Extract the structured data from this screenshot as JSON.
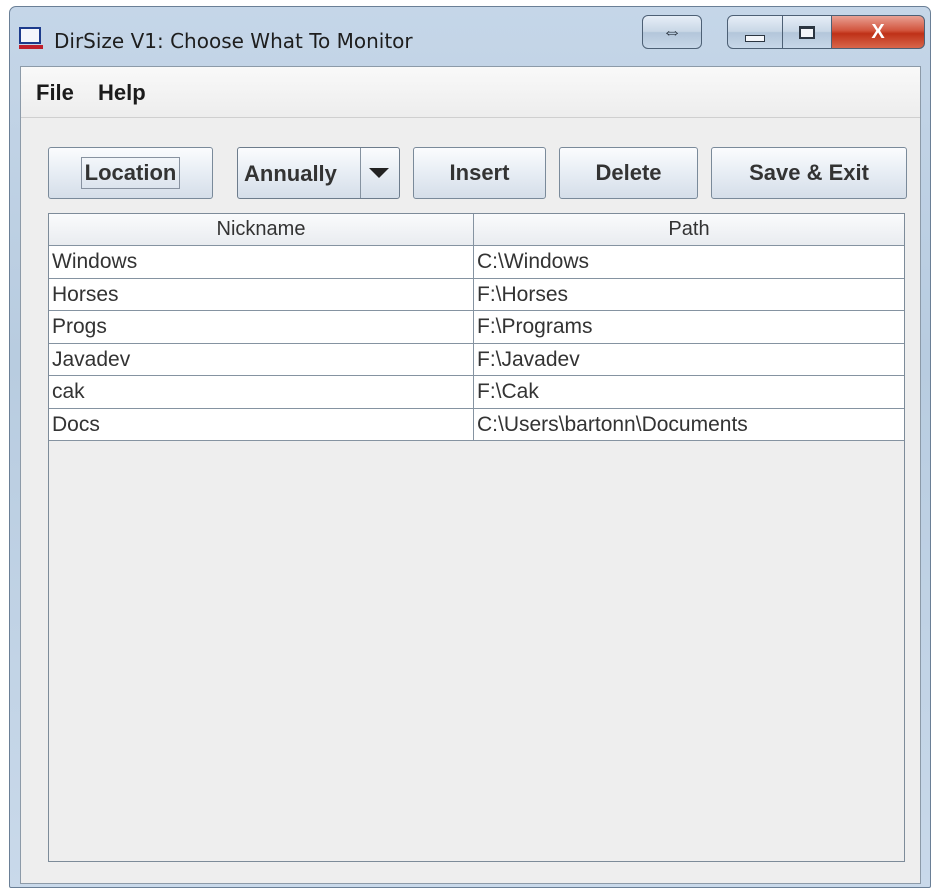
{
  "window": {
    "title": "DirSize V1: Choose What To Monitor",
    "swap_glyph": "⇔",
    "close_glyph": "X"
  },
  "menu": {
    "items": [
      {
        "label": "File"
      },
      {
        "label": "Help"
      }
    ]
  },
  "toolbar": {
    "location_label": "Location",
    "frequency_value": "Annually",
    "insert_label": "Insert",
    "delete_label": "Delete",
    "save_label": "Save & Exit"
  },
  "table": {
    "columns": [
      "Nickname",
      "Path"
    ],
    "rows": [
      {
        "nickname": "Windows",
        "path": "C:\\Windows"
      },
      {
        "nickname": "Horses",
        "path": "F:\\Horses"
      },
      {
        "nickname": "Progs",
        "path": "F:\\Programs"
      },
      {
        "nickname": "Javadev",
        "path": "F:\\Javadev"
      },
      {
        "nickname": "cak",
        "path": "F:\\Cak"
      },
      {
        "nickname": "Docs",
        "path": "C:\\Users\\bartonn\\Documents"
      }
    ]
  }
}
